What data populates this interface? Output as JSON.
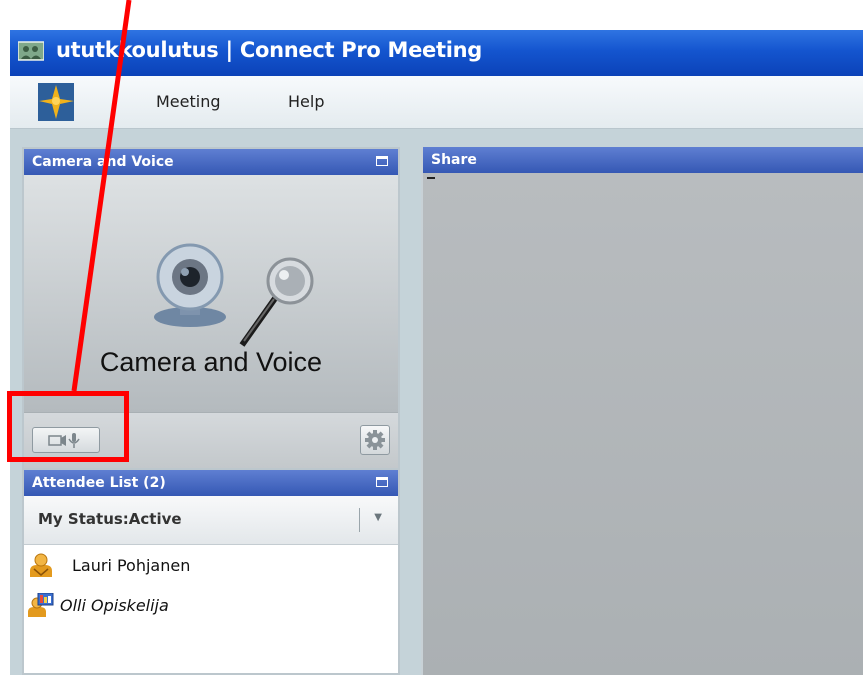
{
  "window": {
    "title": "ututkkoulutus | Connect Pro Meeting"
  },
  "menu": {
    "items": [
      "Meeting",
      "Help"
    ]
  },
  "camera_pod": {
    "header": "Camera and Voice",
    "label": "Camera and Voice"
  },
  "share_pod": {
    "header": "Share"
  },
  "attendee_pod": {
    "header": "Attendee List (2)",
    "status": "My Status:Active",
    "attendees": [
      {
        "name": "Lauri Pohjanen",
        "role": "host",
        "italic": false
      },
      {
        "name": "Olli Opiskelija",
        "role": "participant",
        "italic": true
      }
    ]
  },
  "colors": {
    "titlebar": "#1455cf",
    "pod_header": "#4566c2",
    "annotation": "#ff0000"
  },
  "icons": [
    "app-icon",
    "connect-logo",
    "webcam-microphone-graphic",
    "camera-voice-toggle-icon",
    "gear-icon",
    "chevron-down-icon",
    "host-user-icon",
    "participant-user-icon",
    "maximize-icon"
  ]
}
